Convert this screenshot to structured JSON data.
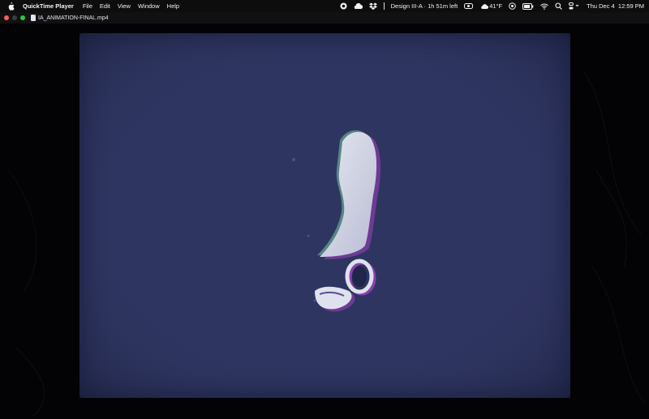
{
  "menubar": {
    "app_name": "QuickTime Player",
    "menus": [
      "File",
      "Edit",
      "View",
      "Window",
      "Help"
    ],
    "status": {
      "event": "Design III-A · 1h 51m left",
      "weather": "41°F",
      "datetime": "Thu Dec 4  12:59 PM"
    },
    "icons": [
      "apple-icon",
      "record-icon",
      "creative-cloud-icon",
      "dropbox-icon",
      "cloud-icon",
      "timer-icon",
      "battery-icon",
      "wifi-icon",
      "search-icon",
      "control-center-icon"
    ]
  },
  "window": {
    "title": "IA_ANIMATION-FINAL.mp4"
  },
  "colors": {
    "video_background": "#2e3560",
    "menubar": "#0d0d0d",
    "close": "#ff5f57",
    "zoom": "#28c840"
  }
}
